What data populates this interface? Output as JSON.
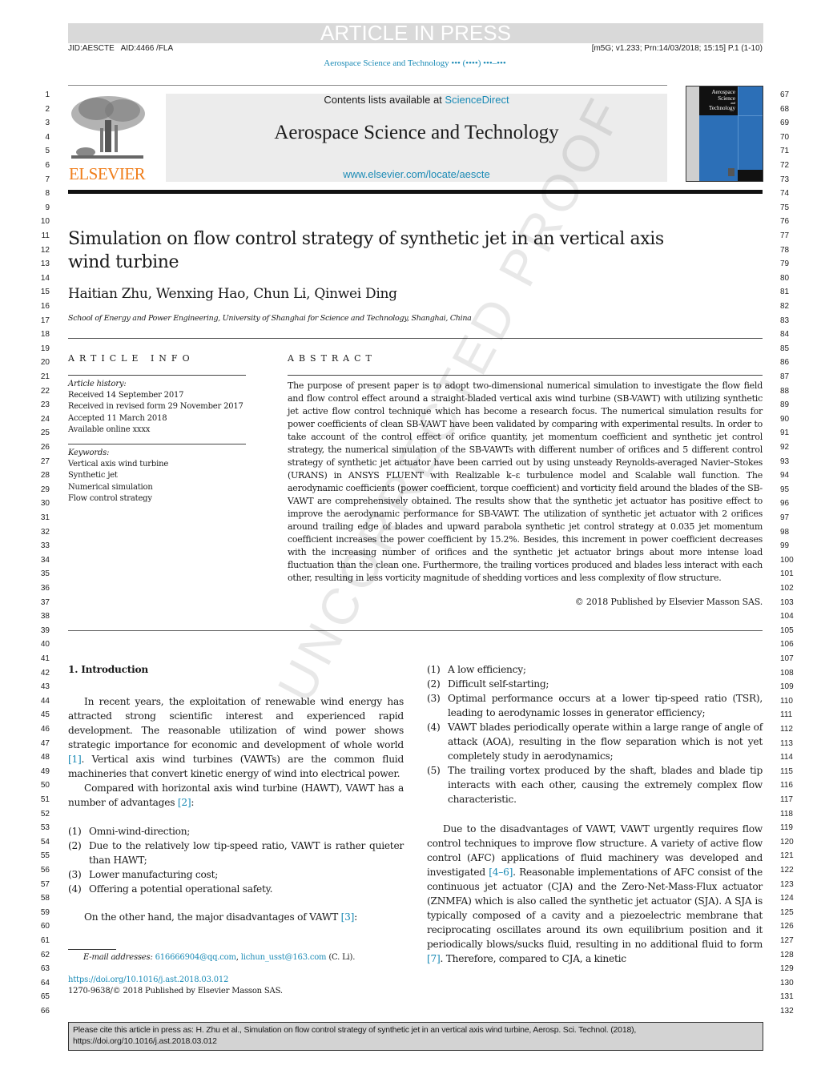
{
  "banner": {
    "article_in_press": "ARTICLE IN PRESS",
    "jid": "JID:AESCTE   AID:4466 /FLA",
    "print_info": "[m5G; v1.233; Prn:14/03/2018; 15:15] P.1 (1-10)",
    "running_head": "Aerospace Science and Technology ••• (••••) •••–•••"
  },
  "masthead": {
    "contents_prefix": "Contents lists available at ",
    "contents_link": "ScienceDirect",
    "journal_name": "Aerospace Science and Technology",
    "journal_url": "www.elsevier.com/locate/aescte",
    "publisher_logo_text": "ELSEVIER",
    "cover_title_lines": [
      "Aerospace",
      "Science",
      "and",
      "Technology"
    ]
  },
  "article": {
    "title": "Simulation on flow control strategy of synthetic jet in an vertical axis wind turbine",
    "authors": "Haitian Zhu, Wenxing Hao, Chun Li, Qinwei Ding",
    "affiliation": "School of Energy and Power Engineering, University of Shanghai for Science and Technology, Shanghai, China"
  },
  "article_info": {
    "heading": "ARTICLE INFO",
    "history_label": "Article history:",
    "history": [
      "Received 14 September 2017",
      "Received in revised form 29 November 2017",
      "Accepted 11 March 2018",
      "Available online xxxx"
    ],
    "keywords_label": "Keywords:",
    "keywords": [
      "Vertical axis wind turbine",
      "Synthetic jet",
      "Numerical simulation",
      "Flow control strategy"
    ]
  },
  "abstract": {
    "heading": "ABSTRACT",
    "text": "The purpose of present paper is to adopt two-dimensional numerical simulation to investigate the flow field and flow control effect around a straight-bladed vertical axis wind turbine (SB-VAWT) with utilizing synthetic jet active flow control technique which has become a research focus. The numerical simulation results for power coefficients of clean SB-VAWT have been validated by comparing with experimental results. In order to take account of the control effect of orifice quantity, jet momentum coefficient and synthetic jet control strategy, the numerical simulation of the SB-VAWTs with different number of orifices and 5 different control strategy of synthetic jet actuator have been carried out by using unsteady Reynolds-averaged Navier–Stokes (URANS) in ANSYS FLUENT with Realizable k–ε turbulence model and Scalable wall function. The aerodynamic coefficients (power coefficient, torque coefficient) and vorticity field around the blades of the SB-VAWT are comprehensively obtained. The results show that the synthetic jet actuator has positive effect to improve the aerodynamic performance for SB-VAWT. The utilization of synthetic jet actuator with 2 orifices around trailing edge of blades and upward parabola synthetic jet control strategy at 0.035 jet momentum coefficient increases the power coefficient by 15.2%. Besides, this increment in power coefficient decreases with the increasing number of orifices and the synthetic jet actuator brings about more intense load fluctuation than the clean one. Furthermore, the trailing vortices produced and blades less interact with each other, resulting in less vorticity magnitude of shedding vortices and less complexity of flow structure.",
    "copyright": "© 2018 Published by Elsevier Masson SAS."
  },
  "body": {
    "section_heading": "1. Introduction",
    "para1_a": "In recent years, the exploitation of renewable wind energy has attracted strong scientific interest and experienced rapid development. The reasonable utilization of wind power shows strategic importance for economic and development of whole world ",
    "ref1": "[1]",
    "para1_b": ". Vertical axis wind turbines (VAWTs) are the common fluid machineries that convert kinetic energy of wind into electrical power.",
    "para2_a": "Compared with horizontal axis wind turbine (HAWT), VAWT has a number of advantages ",
    "ref2": "[2]",
    "para2_b": ":",
    "advantages": [
      {
        "num": "(1)",
        "text": "Omni-wind-direction;"
      },
      {
        "num": "(2)",
        "text": "Due to the relatively low tip-speed ratio, VAWT is rather quieter than HAWT;"
      },
      {
        "num": "(3)",
        "text": "Lower manufacturing cost;"
      },
      {
        "num": "(4)",
        "text": "Offering a potential operational safety."
      }
    ],
    "para3_a": "On the other hand, the major disadvantages of VAWT ",
    "ref3": "[3]",
    "para3_b": ":",
    "disadvantages": [
      {
        "num": "(1)",
        "text": "A low efficiency;"
      },
      {
        "num": "(2)",
        "text": "Difficult self-starting;"
      },
      {
        "num": "(3)",
        "text": "Optimal performance occurs at a lower tip-speed ratio (TSR), leading to aerodynamic losses in generator efficiency;"
      },
      {
        "num": "(4)",
        "text": "VAWT blades periodically operate within a large range of angle of attack (AOA), resulting in the flow separation which is not yet completely study in aerodynamics;"
      },
      {
        "num": "(5)",
        "text": "The trailing vortex produced by the shaft, blades and blade tip interacts with each other, causing the extremely complex flow characteristic."
      }
    ],
    "para4_a": "Due to the disadvantages of VAWT, VAWT urgently requires flow control techniques to improve flow structure. A variety of active flow control (AFC) applications of fluid machinery was developed and investigated ",
    "ref4": "[4–6]",
    "para4_b": ". Reasonable implementations of AFC consist of the continuous jet actuator (CJA) and the Zero-Net-Mass-Flux actuator (ZNMFA) which is also called the synthetic jet actuator (SJA). A SJA is typically composed of a cavity and a piezoelectric membrane that reciprocating oscillates around its own equilibrium position and it periodically blows/sucks fluid, resulting in no additional fluid to form ",
    "ref5": "[7]",
    "para4_c": ". Therefore, compared to CJA, a kinetic"
  },
  "footnote": {
    "label": "E-mail addresses: ",
    "email1": "616666904@qq.com",
    "sep": ", ",
    "email2": "lichun_usst@163.com",
    "suffix": " (C. Li).",
    "doi": "https://doi.org/10.1016/j.ast.2018.03.012",
    "issn": "1270-9638/© 2018 Published by Elsevier Masson SAS."
  },
  "citation_box": {
    "text": "Please cite this article in press as: H. Zhu et al., Simulation on flow control strategy of synthetic jet in an vertical axis wind turbine, Aerosp. Sci. Technol. (2018), https://doi.org/10.1016/j.ast.2018.03.012"
  },
  "watermark": "UNCORRECTED PROOF",
  "line_numbers": {
    "left_start": 1,
    "left_end": 66,
    "right_start": 67,
    "right_end": 132
  },
  "colors": {
    "link": "#1a8ab5",
    "elsevier_orange": "#f07e1b",
    "cover_blue": "#2c6fb7",
    "banner_gray": "#d9d9d9"
  }
}
